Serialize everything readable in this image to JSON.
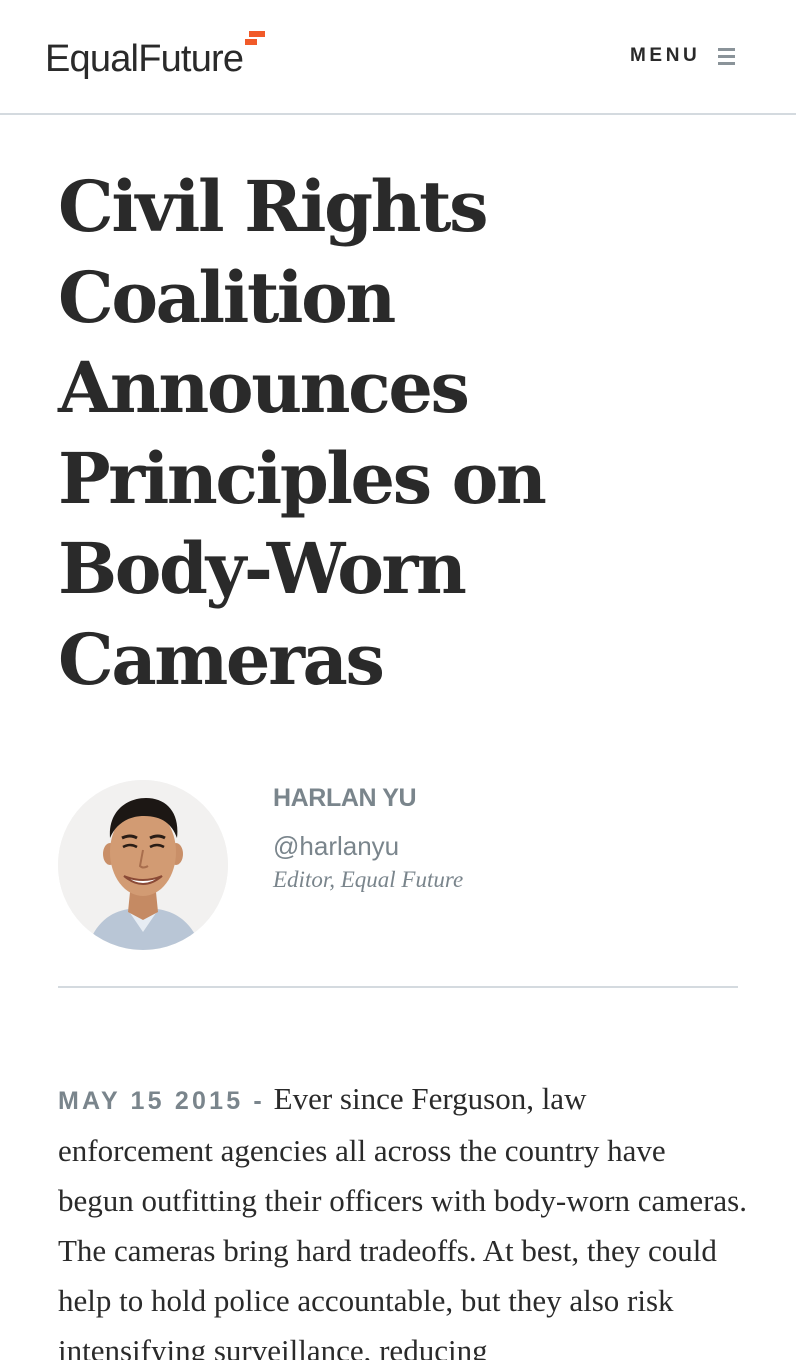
{
  "header": {
    "logo_text": "EqualFuture",
    "menu_label": "MENU",
    "brand_color": "#f15a29"
  },
  "article": {
    "headline": "Civil Rights Coalition Announces Principles on Body-Worn Cameras",
    "author": {
      "name": "HARLAN YU",
      "handle": "@harlanyu",
      "role": "Editor, Equal Future"
    },
    "dateline": "MAY 15 2015",
    "dateline_separator": "-",
    "lead": "Ever since Ferguson, law enforcement agencies all across the country have begun outfitting their officers with body-worn cameras. The cameras bring hard tradeoffs. At best, they could help to hold police accountable, but they also risk intensifying surveillance, reducing"
  },
  "icons": {
    "menu": "hamburger-icon",
    "logo_mark": "flag-icon"
  }
}
